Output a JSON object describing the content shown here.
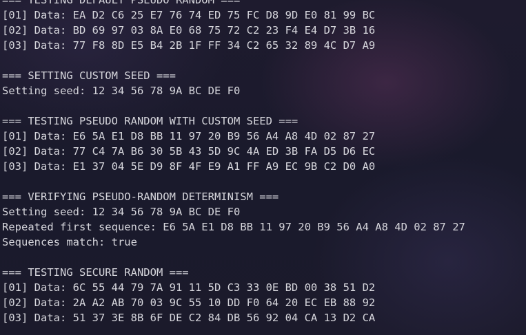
{
  "terminal": {
    "lines": [
      "=== TESTING DEFAULT PSEUDO RANDOM ===",
      "[01] Data: EA D2 C6 25 E7 76 74 ED 75 FC D8 9D E0 81 99 BC",
      "[02] Data: BD 69 97 03 8A E0 68 75 72 C2 23 F4 E4 D7 3B 16",
      "[03] Data: 77 F8 8D E5 B4 2B 1F FF 34 C2 65 32 89 4C D7 A9",
      "",
      "=== SETTING CUSTOM SEED ===",
      "Setting seed: 12 34 56 78 9A BC DE F0",
      "",
      "=== TESTING PSEUDO RANDOM WITH CUSTOM SEED ===",
      "[01] Data: E6 5A E1 D8 BB 11 97 20 B9 56 A4 A8 4D 02 87 27",
      "[02] Data: 77 C4 7A B6 30 5B 43 5D 9C 4A ED 3B FA D5 D6 EC",
      "[03] Data: E1 37 04 5E D9 8F 4F E9 A1 FF A9 EC 9B C2 D0 A0",
      "",
      "=== VERIFYING PSEUDO-RANDOM DETERMINISM ===",
      "Setting seed: 12 34 56 78 9A BC DE F0",
      "Repeated first sequence: E6 5A E1 D8 BB 11 97 20 B9 56 A4 A8 4D 02 87 27",
      "Sequences match: true",
      "",
      "=== TESTING SECURE RANDOM ===",
      "[01] Data: 6C 55 44 79 7A 91 11 5D C3 33 0E BD 00 38 51 D2",
      "[02] Data: 2A A2 AB 70 03 9C 55 10 DD F0 64 20 EC EB 88 92",
      "[03] Data: 51 37 3E 8B 6F DE C2 84 DB 56 92 04 CA 13 D2 CA"
    ]
  }
}
